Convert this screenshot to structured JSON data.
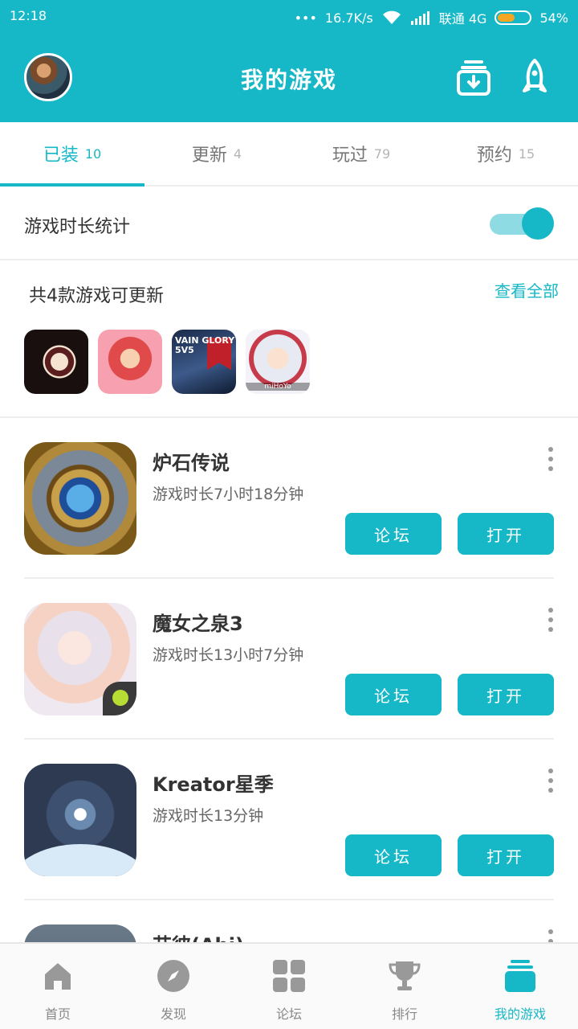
{
  "status_bar": {
    "time": "12:18",
    "dots": "•••",
    "speed": "16.7K/s",
    "carrier": "联通 4G",
    "battery": "54%",
    "battery_level": 0.54
  },
  "header": {
    "title": "我的游戏",
    "avatar": "avatar",
    "download_icon": "download-box-icon",
    "rocket_icon": "rocket-icon"
  },
  "tabs": [
    {
      "label": "已装",
      "count": "10",
      "active": true
    },
    {
      "label": "更新",
      "count": "4",
      "active": false
    },
    {
      "label": "玩过",
      "count": "79",
      "active": false
    },
    {
      "label": "预约",
      "count": "15",
      "active": false
    }
  ],
  "playtime_stats": {
    "label": "游戏时长统计",
    "toggle_on": true
  },
  "updates": {
    "label": "共4款游戏可更新",
    "view_all": "查看全部",
    "icons": [
      {
        "icon": "dark-spiral-game-icon"
      },
      {
        "icon": "red-lion-dance-game-icon"
      },
      {
        "icon": "vainglory-game-icon",
        "text": "VAIN GLORY 5V5"
      },
      {
        "icon": "anime-girl-game-icon",
        "text": "miHoYo"
      }
    ]
  },
  "games": [
    {
      "name": "炉石传说",
      "playtime": "游戏时长7小时18分钟",
      "forum": "论坛",
      "open": "打开",
      "icon": "hearthstone-icon"
    },
    {
      "name": "魔女之泉3",
      "playtime": "游戏时长13小时7分钟",
      "forum": "论坛",
      "open": "打开",
      "icon": "witch-spring-icon"
    },
    {
      "name": "Kreator星季",
      "playtime": "游戏时长13分钟",
      "forum": "论坛",
      "open": "打开",
      "icon": "kreator-icon"
    },
    {
      "name": "艾彼(Abi)",
      "icon": "abi-icon"
    }
  ],
  "bottom_nav": [
    {
      "label": "首页",
      "icon": "home-icon",
      "active": false
    },
    {
      "label": "发现",
      "icon": "compass-icon",
      "active": false
    },
    {
      "label": "论坛",
      "icon": "grid-icon",
      "active": false
    },
    {
      "label": "排行",
      "icon": "trophy-icon",
      "active": false
    },
    {
      "label": "我的游戏",
      "icon": "my-games-icon",
      "active": true
    }
  ],
  "colors": {
    "accent": "#16b8c7",
    "toggle_track": "#8fdbe3",
    "nav_inactive": "#999999"
  }
}
